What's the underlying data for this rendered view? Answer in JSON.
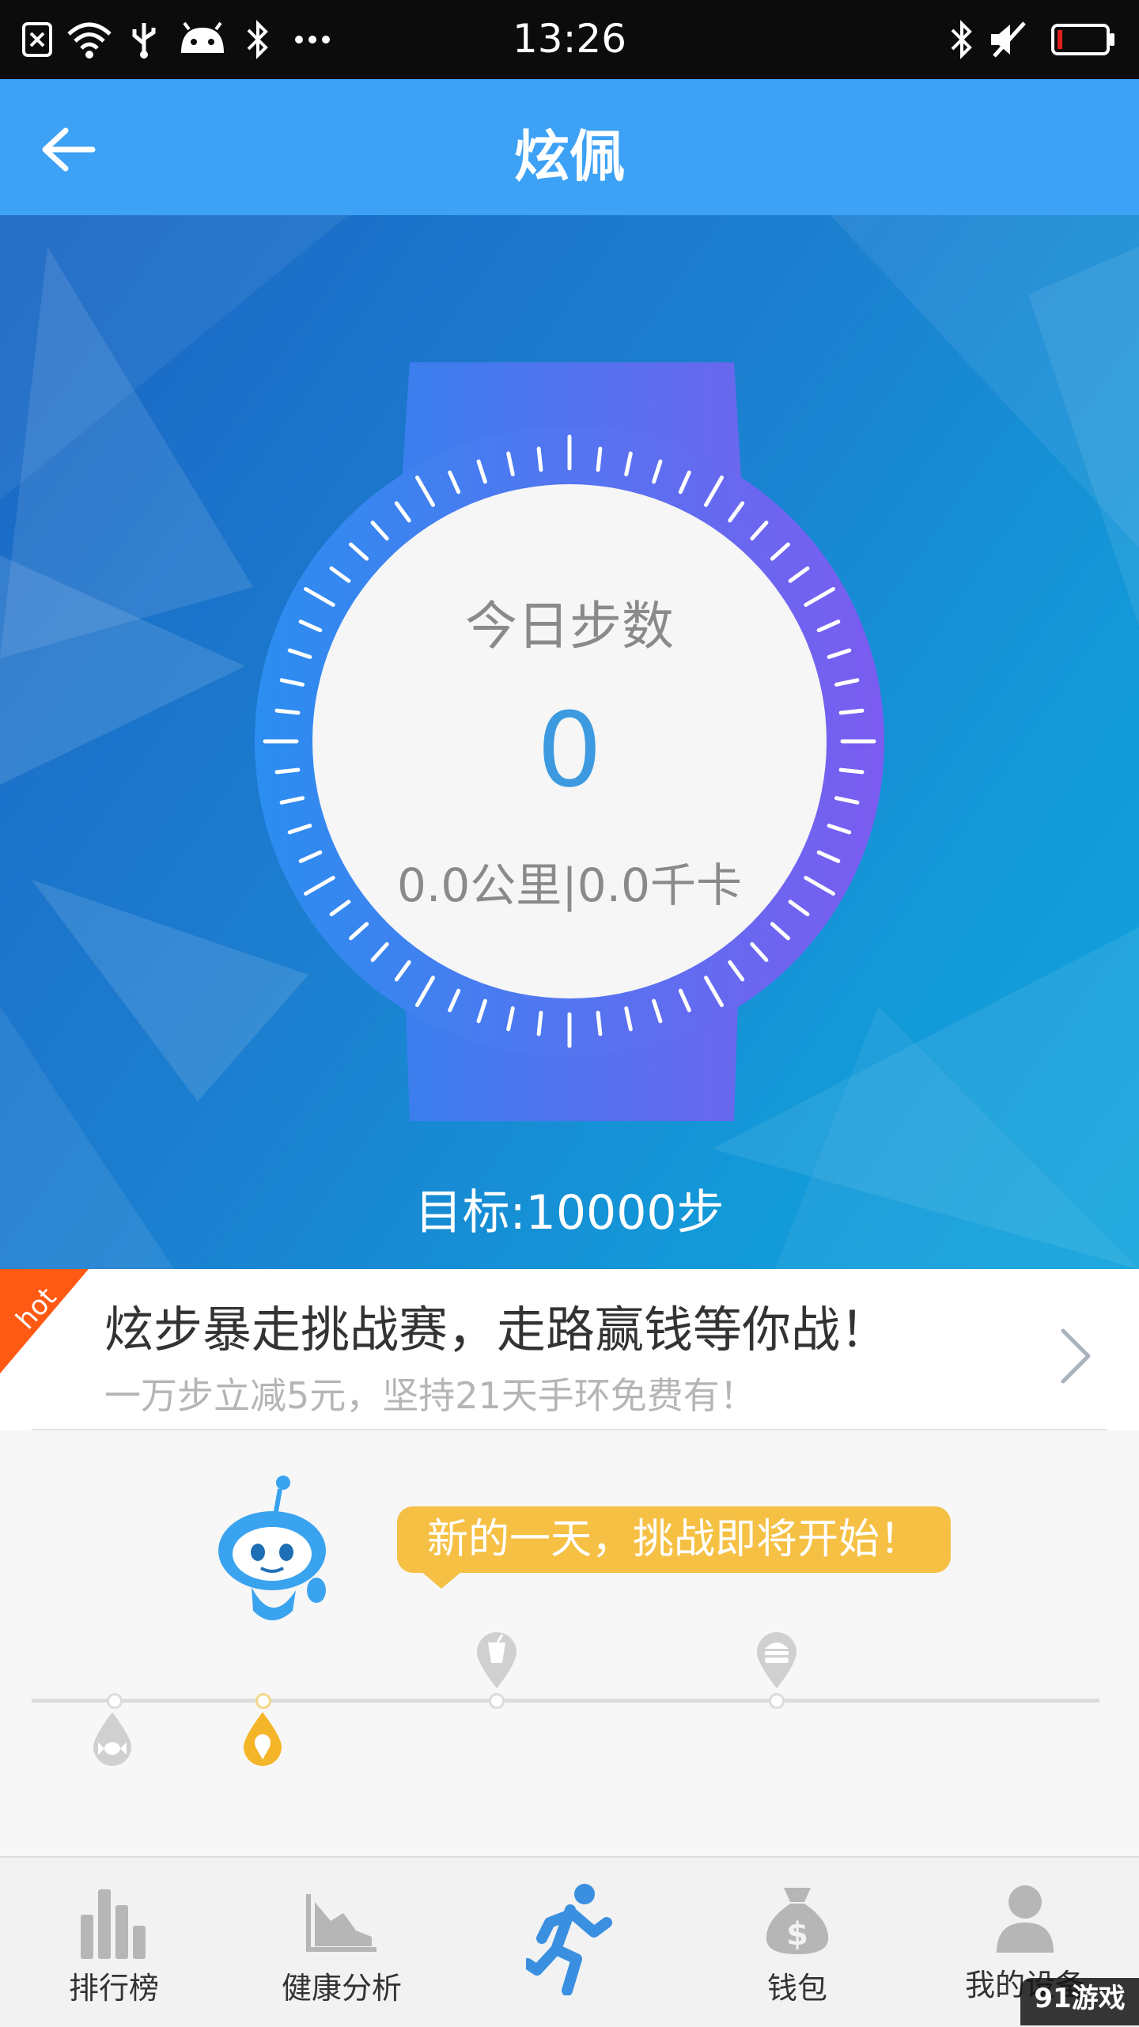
{
  "status_bar": {
    "time": "13:26",
    "icons": [
      "sim-off-icon",
      "wifi-icon",
      "usb-icon",
      "android-debug-icon",
      "bluetooth-icon",
      "more-dots-icon",
      "bluetooth-icon",
      "mute-icon",
      "battery-low-icon"
    ]
  },
  "app_bar": {
    "title": "炫佩",
    "back_icon": "arrow-left-icon"
  },
  "steps_card": {
    "label": "今日步数",
    "value": "0",
    "distance_calories": "0.0公里|0.0千卡",
    "goal": "目标:10000步"
  },
  "promo": {
    "ribbon": "hot",
    "title": "炫步暴走挑战赛，走路赢钱等你战！",
    "subtitle": "一万步立减5元，坚持21天手环免费有！",
    "chevron_icon": "chevron-right-icon"
  },
  "challenge": {
    "bubble_text": "新的一天，挑战即将开始！",
    "milestones": [
      {
        "icon": "candy-icon",
        "active": false,
        "side": "below"
      },
      {
        "icon": "ice-cream-icon",
        "active": true,
        "side": "below"
      },
      {
        "icon": "drink-icon",
        "active": false,
        "side": "above"
      },
      {
        "icon": "burger-icon",
        "active": false,
        "side": "above"
      }
    ]
  },
  "tab_bar": {
    "tabs": [
      {
        "label": "排行榜",
        "icon": "bar-chart-icon"
      },
      {
        "label": "健康分析",
        "icon": "area-chart-icon"
      },
      {
        "label": "",
        "icon": "running-person-icon",
        "active": true
      },
      {
        "label": "钱包",
        "icon": "money-bag-icon"
      },
      {
        "label": "我的设备",
        "icon": "person-icon"
      }
    ]
  },
  "watermark": "91游戏",
  "colors": {
    "app_bar": "#3da1f5",
    "accent_blue": "#3d9ae0",
    "bubble_yellow": "#f5c044",
    "ribbon_orange": "#ff5a14",
    "active_tab": "#3a8fe0"
  }
}
